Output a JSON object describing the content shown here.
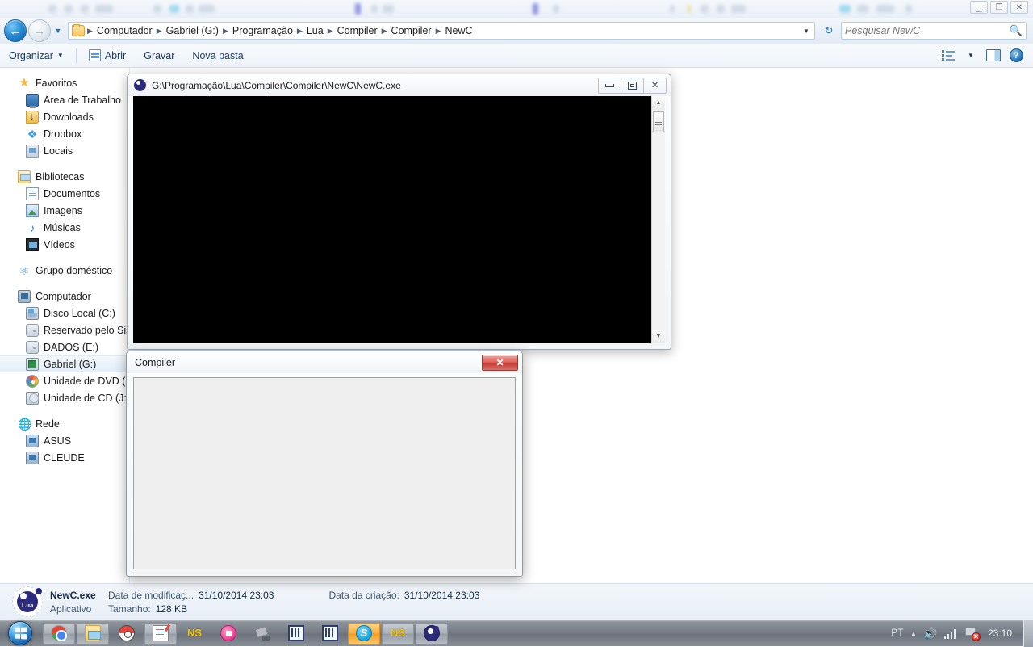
{
  "background_window": {
    "controls": [
      "minimize-icon",
      "restore-icon",
      "close-icon"
    ]
  },
  "explorer": {
    "address_bar": {
      "back_label": "←",
      "forward_label": "→",
      "recent_pages_chevron": "▼",
      "folder_icon": "folder-icon",
      "breadcrumbs": [
        "Computador",
        "Gabriel (G:)",
        "Programação",
        "Lua",
        "Compiler",
        "Compiler",
        "NewC"
      ],
      "separator": "▶",
      "dropdown_chevron": "▼",
      "refresh_label": "↻",
      "search": {
        "placeholder": "Pesquisar NewC",
        "value": "",
        "icon": "search-icon"
      }
    },
    "toolbar": {
      "organize_label": "Organizar",
      "organize_caret": "▼",
      "open_label": "Abrir",
      "burn_label": "Gravar",
      "new_folder_label": "Nova pasta",
      "views_caret": "▼",
      "icons": [
        "views-icon",
        "preview-pane-icon",
        "help-icon"
      ],
      "help_glyph": "?"
    },
    "navigation_pane": {
      "groups": [
        {
          "header": {
            "label": "Favoritos",
            "icon": "star-icon"
          },
          "items": [
            {
              "label": "Área de Trabalho",
              "icon": "desktop-icon"
            },
            {
              "label": "Downloads",
              "icon": "downloads-icon"
            },
            {
              "label": "Dropbox",
              "icon": "dropbox-icon"
            },
            {
              "label": "Locais",
              "icon": "places-icon"
            }
          ]
        },
        {
          "header": {
            "label": "Bibliotecas",
            "icon": "libraries-icon"
          },
          "items": [
            {
              "label": "Documentos",
              "icon": "documents-icon"
            },
            {
              "label": "Imagens",
              "icon": "pictures-icon"
            },
            {
              "label": "Músicas",
              "icon": "music-icon"
            },
            {
              "label": "Vídeos",
              "icon": "videos-icon"
            }
          ]
        },
        {
          "header": {
            "label": "Grupo doméstico",
            "icon": "homegroup-icon"
          },
          "items": []
        },
        {
          "header": {
            "label": "Computador",
            "icon": "computer-icon"
          },
          "items": [
            {
              "label": "Disco Local (C:)",
              "icon": "local-disk-icon"
            },
            {
              "label": "Reservado pelo Sistema",
              "icon": "drive-icon"
            },
            {
              "label": "DADOS (E:)",
              "icon": "drive-icon"
            },
            {
              "label": "Gabriel (G:)",
              "icon": "network-drive-icon",
              "selected": true
            },
            {
              "label": "Unidade de DVD (H:)",
              "icon": "dvd-drive-icon"
            },
            {
              "label": "Unidade de CD (J:)",
              "icon": "cd-drive-icon"
            }
          ]
        },
        {
          "header": {
            "label": "Rede",
            "icon": "network-icon"
          },
          "items": [
            {
              "label": "ASUS",
              "icon": "computer-node-icon"
            },
            {
              "label": "CLEUDE",
              "icon": "computer-node-icon"
            }
          ]
        }
      ]
    },
    "details_pane": {
      "file_icon": "lua-app-icon",
      "file_name": "NewC.exe",
      "file_type": "Aplicativo",
      "modified_label": "Data de modificaç...",
      "modified_value": "31/10/2014 23:03",
      "created_label": "Data da criação:",
      "created_value": "31/10/2014 23:03",
      "size_label": "Tamanho:",
      "size_value": "128 KB"
    }
  },
  "console_window": {
    "app_icon": "lua-app-icon",
    "title": "G:\\Programação\\Lua\\Compiler\\Compiler\\NewC\\NewC.exe",
    "minimize_label": "minimize-icon",
    "maximize_label": "maximize-icon",
    "close_label": "✕",
    "screen_text": "",
    "scrollbar": {
      "up_arrow": "▲",
      "down_arrow": "▼"
    }
  },
  "compiler_dialog": {
    "title": "Compiler",
    "close_label": "✕",
    "panel_text": ""
  },
  "taskbar": {
    "start_label": "start-orb",
    "tasks": [
      {
        "name": "chrome",
        "icon": "chrome-icon",
        "active": false
      },
      {
        "name": "explorer",
        "icon": "explorer-icon",
        "active": false
      },
      {
        "name": "pokemon",
        "icon": "pokeball-icon",
        "active": false,
        "flat": true
      },
      {
        "name": "notepad",
        "icon": "notepad-icon",
        "active": false
      },
      {
        "name": "ns-app",
        "icon": "ns-icon",
        "active": false,
        "flat": true
      },
      {
        "name": "recorder",
        "icon": "record-icon",
        "active": false,
        "flat": true
      },
      {
        "name": "tool",
        "icon": "tool-icon",
        "active": false,
        "flat": true
      },
      {
        "name": "bars-1",
        "icon": "bars-icon",
        "active": false,
        "flat": true
      },
      {
        "name": "bars-2",
        "icon": "bars-icon",
        "active": false,
        "flat": true
      },
      {
        "name": "skype",
        "icon": "skype-icon",
        "active": true
      },
      {
        "name": "ns-app-2",
        "icon": "ns-icon",
        "active": false
      },
      {
        "name": "newc",
        "icon": "lua-icon",
        "active": false
      }
    ],
    "tray": {
      "language": "PT",
      "expand_chevron": "▲",
      "volume_icon": "volume-icon",
      "signal_icon": "signal-icon",
      "network_icon": "network-error-icon",
      "network_error_glyph": "✕",
      "clock": "23:10"
    }
  },
  "colors": {
    "accent": "#1f72b8",
    "close_red": "#c63b33",
    "taskbar_active": "#f59a1e",
    "console_bg": "#000000"
  }
}
